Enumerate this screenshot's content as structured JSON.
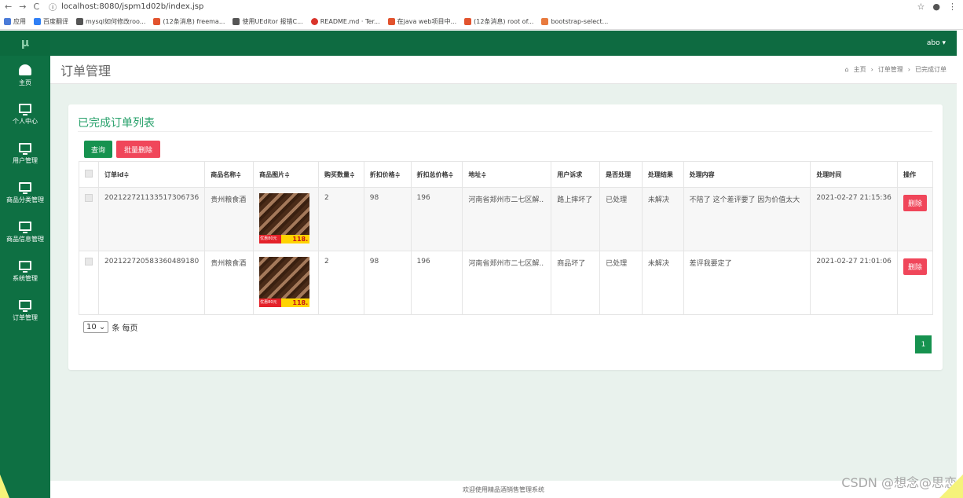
{
  "browser": {
    "url": "localhost:8080/jspm1d02b/index.jsp",
    "bookmarks": [
      {
        "label": "应用",
        "color": "#4a7bd8"
      },
      {
        "label": "百度翻译",
        "color": "#2f7ff5"
      },
      {
        "label": "mysql如何修改roo...",
        "color": "#555555"
      },
      {
        "label": "(12条消息) freema...",
        "color": "#e2532e"
      },
      {
        "label": "使用UEditor 报错C...",
        "color": "#555555"
      },
      {
        "label": "README.md · Ter...",
        "color": "#d9342b"
      },
      {
        "label": "在java web项目中...",
        "color": "#e2532e"
      },
      {
        "label": "(12条消息) root of...",
        "color": "#e2532e"
      },
      {
        "label": "bootstrap-select...",
        "color": "#e87a3e"
      }
    ]
  },
  "app": {
    "logo": "μ",
    "user": "abo ▾",
    "sidebar": [
      {
        "label": "主页",
        "icon": "dashboard-icon"
      },
      {
        "label": "个人中心",
        "icon": "monitor-icon"
      },
      {
        "label": "用户管理",
        "icon": "monitor-icon"
      },
      {
        "label": "商品分类管理",
        "icon": "monitor-icon"
      },
      {
        "label": "商品信息管理",
        "icon": "monitor-icon"
      },
      {
        "label": "系统管理",
        "icon": "monitor-icon"
      },
      {
        "label": "订单管理",
        "icon": "monitor-icon"
      }
    ]
  },
  "header": {
    "title": "订单管理",
    "breadcrumb": [
      "主页",
      "订单管理",
      "已完成订单"
    ]
  },
  "card": {
    "title": "已完成订单列表",
    "query_label": "查询",
    "batch_delete_label": "批量删除"
  },
  "table": {
    "columns": [
      "订单id≑",
      "商品名称≑",
      "商品图片≑",
      "购买数量≑",
      "折扣价格≑",
      "折扣总价格≑",
      "地址≑",
      "用户诉求",
      "是否处理",
      "处理结果",
      "处理内容",
      "处理时间",
      "操作"
    ],
    "rows": [
      {
        "id": "202122721133517306736",
        "name": "贵州粮食酒",
        "img_sale": "优惠80元",
        "img_price": "118.",
        "qty": "2",
        "price": "98",
        "total": "196",
        "address": "河南省郑州市二七区解..",
        "request": "路上摔坏了",
        "processed": "已处理",
        "result": "未解决",
        "content": "不陪了 这个差评要了 因为价值太大",
        "time": "2021-02-27 21:15:36",
        "action": "删除"
      },
      {
        "id": "202122720583360489180",
        "name": "贵州粮食酒",
        "img_sale": "优惠80元",
        "img_price": "118.",
        "qty": "2",
        "price": "98",
        "total": "196",
        "address": "河南省郑州市二七区解..",
        "request": "商品坏了",
        "processed": "已处理",
        "result": "未解决",
        "content": "差评我要定了",
        "time": "2021-02-27 21:01:06",
        "action": "删除"
      }
    ]
  },
  "pager": {
    "size": "10",
    "per_page_label": "条 每页",
    "current_page": "1"
  },
  "footer": "欢迎使用精品酒销售管理系统",
  "watermark": "CSDN @想念@思恋"
}
